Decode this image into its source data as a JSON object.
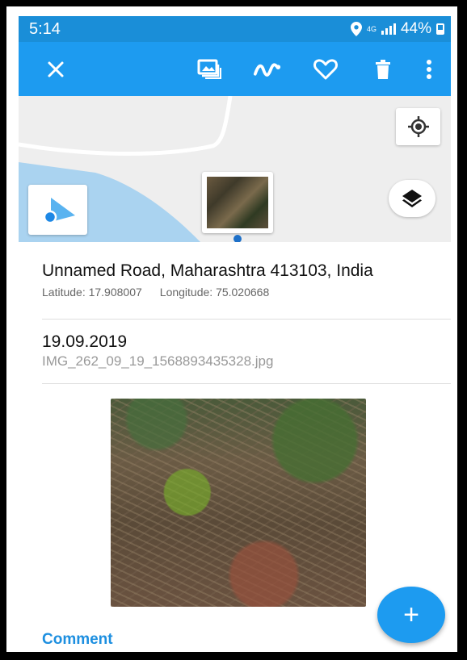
{
  "status_bar": {
    "time": "5:14",
    "network": "4G",
    "battery": "44%"
  },
  "app_bar": {
    "icons": [
      "close-icon",
      "gallery-icon",
      "track-icon",
      "favorite-icon",
      "delete-icon",
      "more-vert-icon"
    ]
  },
  "map": {
    "icons": [
      "my-location-icon",
      "compass-icon",
      "layers-icon"
    ]
  },
  "details": {
    "address": "Unnamed Road, Maharashtra 413103, India",
    "latitude": "Latitude: 17.908007",
    "longitude": "Longitude: 75.020668",
    "date": "19.09.2019",
    "filename": "IMG_262_09_19_1568893435328.jpg"
  },
  "comment_label": "Comment",
  "fab_icon": "+",
  "colors": {
    "status_bar": "#1a8ed8",
    "app_bar": "#1d9bf0",
    "accent": "#1d8fe0"
  }
}
